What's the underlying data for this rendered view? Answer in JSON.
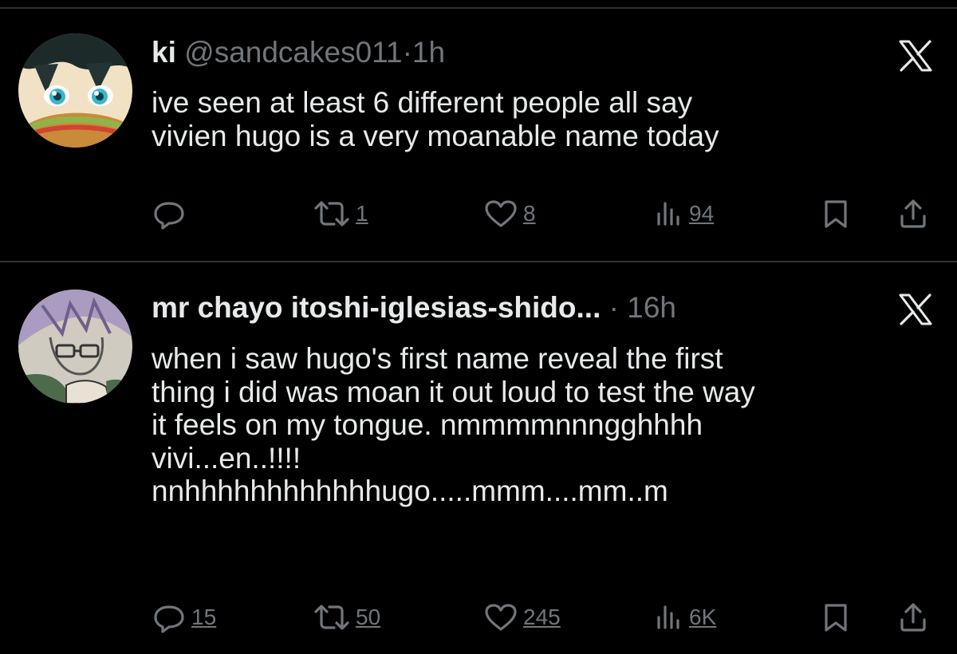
{
  "colors": {
    "background": "#000000",
    "text_primary": "#e7e9ea",
    "text_secondary": "#71767b",
    "divider": "#2f3336"
  },
  "tweets": [
    {
      "display_name": "ki",
      "handle": "@sandcakes011",
      "separator": "·",
      "time": "1h",
      "text": "ive seen at least 6 different people all say\nvivien hugo is a very moanable name today",
      "replies": "",
      "retweets": "1",
      "likes": "8",
      "views": "94",
      "avatar_icon": "anime-avatar-icon",
      "source_icon": "x-logo-icon"
    },
    {
      "display_name": "mr chayo itoshi-iglesias-shido...",
      "handle": "",
      "separator": "·",
      "time": "16h",
      "text": "when i saw hugo's first name reveal the first\nthing i did was moan it out loud to test the way\nit feels on my tongue. nmmmmnnngghhhh\nvivi...en..!!!!\nnnhhhhhhhhhhhhugo.....mmm....mm..m",
      "replies": "15",
      "retweets": "50",
      "likes": "245",
      "views": "6K",
      "avatar_icon": "anime-avatar-icon",
      "source_icon": "x-logo-icon"
    }
  ]
}
